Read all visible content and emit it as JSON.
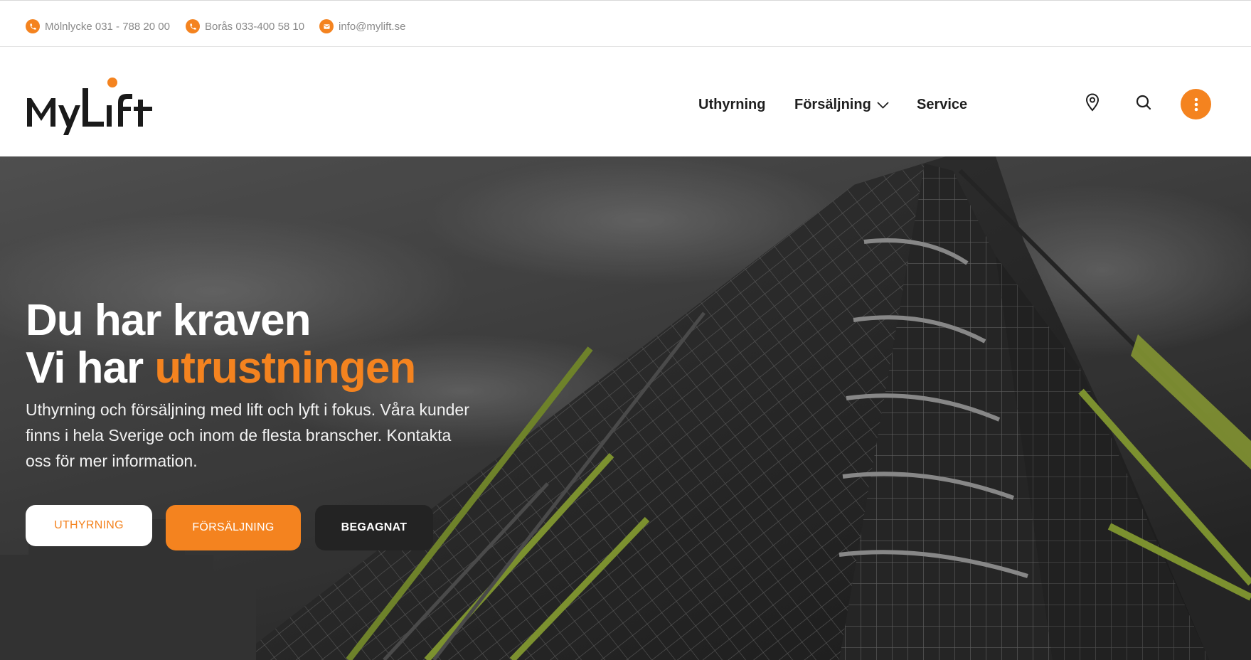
{
  "topbar": {
    "contacts": [
      {
        "icon": "phone-icon",
        "text": "Mölnlycke 031 - 788 20 00"
      },
      {
        "icon": "phone-icon",
        "text": "Borås 033-400 58 10"
      },
      {
        "icon": "mail-icon",
        "text": "info@mylift.se"
      }
    ]
  },
  "header": {
    "logo_text": "MyLift",
    "nav": [
      {
        "label": "Uthyrning"
      },
      {
        "label": "Försäljning",
        "has_dropdown": true
      },
      {
        "label": "Service"
      }
    ],
    "icons": [
      "location-pin-icon",
      "search-icon",
      "more-vertical-icon"
    ]
  },
  "hero": {
    "title_line1": "Du har kraven",
    "title_line2_prefix": "Vi har ",
    "title_line2_accent": "utrustningen",
    "text": "Uthyrning och försäljning med lift och lyft i fokus. Våra kunder finns i hela Sverige och inom de flesta branscher. Kontakta oss för mer information.",
    "buttons": [
      {
        "label": "UTHYRNING"
      },
      {
        "label": "FÖRSÄLJNING"
      },
      {
        "label": "BEGAGNAT"
      }
    ]
  },
  "colors": {
    "accent": "#f4831f",
    "dark_button": "#232323",
    "text_dark": "#1e1e1e",
    "muted_text": "#8a8a8a"
  }
}
